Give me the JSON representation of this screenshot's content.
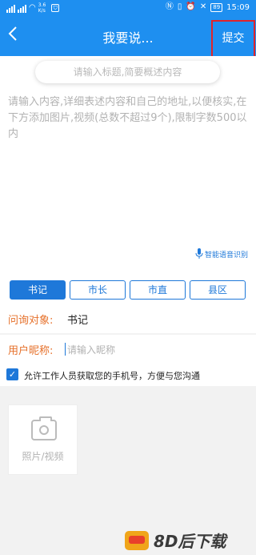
{
  "status_bar": {
    "network_speed": "3.6\nK/s",
    "battery": "89",
    "time": "15:09"
  },
  "nav": {
    "back_icon": "chevron-left-icon",
    "title": "我要说...",
    "submit_label": "提交"
  },
  "form": {
    "title_placeholder": "请输入标题,简要概述内容",
    "content_placeholder": "请输入内容,详细表述内容和自己的地址,以便核实,在下方添加图片,视频(总数不超过9个),限制字数500以内",
    "voice_label": "智能语音识别"
  },
  "tabs": [
    {
      "label": "书记",
      "active": true
    },
    {
      "label": "市长",
      "active": false
    },
    {
      "label": "市直",
      "active": false
    },
    {
      "label": "县区",
      "active": false
    }
  ],
  "target": {
    "label": "问询对象:",
    "value": "书记"
  },
  "nickname": {
    "label": "用户昵称:",
    "placeholder": "请输入昵称"
  },
  "permission": {
    "label": "允许工作人员获取您的手机号，方便与您沟通",
    "checked": true
  },
  "upload": {
    "label": "照片/视频"
  },
  "watermark": {
    "text": "8D后下载"
  },
  "colors": {
    "primary": "#1e8ff0",
    "accent_orange": "#e6702a",
    "highlight_red": "#e0242b"
  }
}
